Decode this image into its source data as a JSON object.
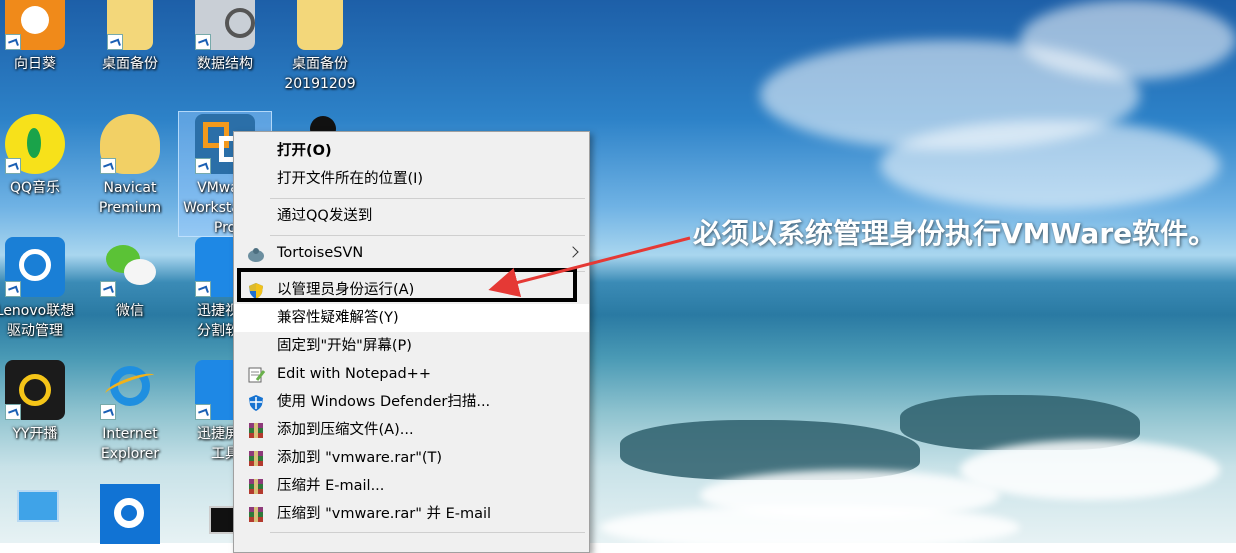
{
  "desktop": {
    "icons": [
      {
        "label": "向日葵"
      },
      {
        "label": "桌面备份"
      },
      {
        "label": "数据结构"
      },
      {
        "label": "桌面备份\n20191209"
      },
      {
        "label": "QQ音乐"
      },
      {
        "label": "Navicat\nPremium"
      },
      {
        "label": "VMware\nWorkstation\nPro"
      },
      {
        "label": "Lenovo联想\n驱动管理"
      },
      {
        "label": "微信"
      },
      {
        "label": "迅捷视频\n分割软件"
      },
      {
        "label": "YY开播"
      },
      {
        "label": "Internet\nExplorer"
      },
      {
        "label": "迅捷屏幕\n工具"
      }
    ]
  },
  "context_menu": {
    "open": "打开(O)",
    "open_location": "打开文件所在的位置(I)",
    "send_qq": "通过QQ发送到",
    "tortoise": "TortoiseSVN",
    "run_admin": "以管理员身份运行(A)",
    "compat": "兼容性疑难解答(Y)",
    "pin_start": "固定到\"开始\"屏幕(P)",
    "notepad": "Edit with Notepad++",
    "defender": "使用 Windows Defender扫描...",
    "add_archive": "添加到压缩文件(A)...",
    "add_rar": "添加到 \"vmware.rar\"(T)",
    "compress_email": "压缩并 E-mail...",
    "compress_rar_email": "压缩到 \"vmware.rar\" 并 E-mail"
  },
  "annotation": {
    "text": "必须以系统管理身份执行VMWare软件。",
    "arrow_color": "#e53935",
    "box_color": "#000000"
  }
}
